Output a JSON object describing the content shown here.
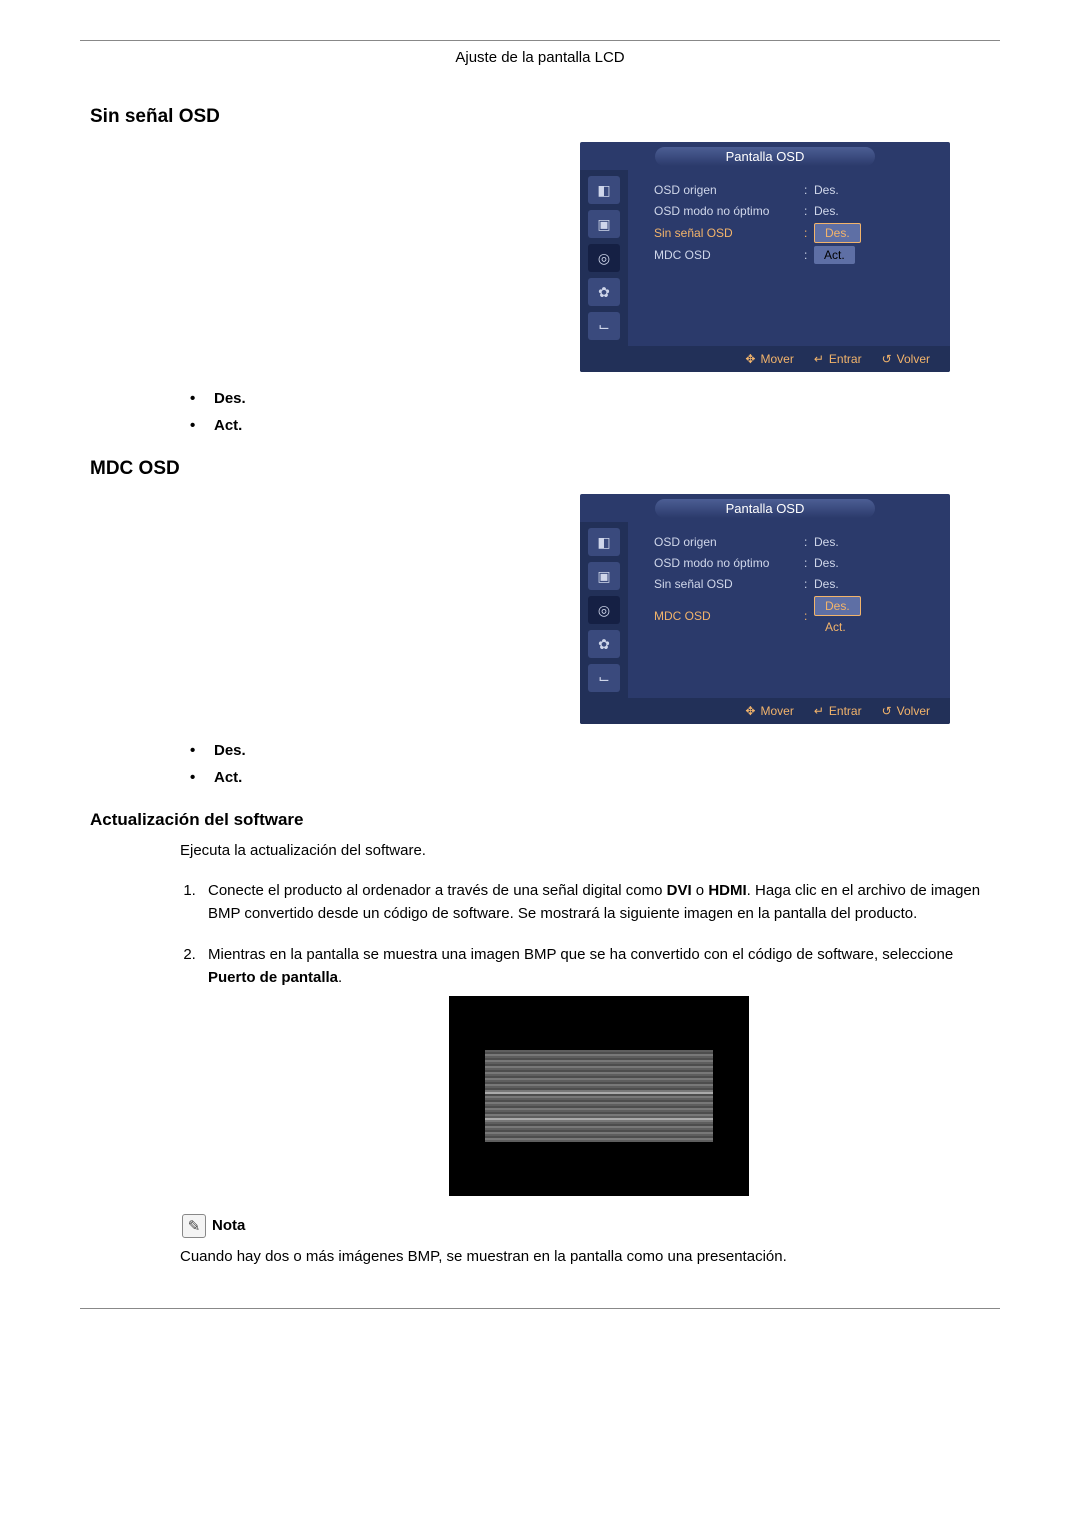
{
  "page_header": "Ajuste de la pantalla LCD",
  "sections": {
    "sin_senal": {
      "title": "Sin señal OSD",
      "bullets": [
        "Des.",
        "Act."
      ]
    },
    "mdc": {
      "title": "MDC OSD",
      "bullets": [
        "Des.",
        "Act."
      ]
    },
    "software": {
      "title": "Actualización del software",
      "intro": "Ejecuta la actualización del software.",
      "step1_a": "Conecte el producto al ordenador a través de una señal digital como ",
      "step1_b": "DVI",
      "step1_c": " o ",
      "step1_d": "HDMI",
      "step1_e": ". Haga clic en el archivo de imagen BMP convertido desde un código de software. Se mostrará la siguiente imagen en la pantalla del producto.",
      "step2_a": "Mientras en la pantalla se muestra una imagen BMP que se ha convertido con el código de software, seleccione ",
      "step2_b": "Puerto de pantalla",
      "step2_c": ".",
      "nota_label": "Nota",
      "nota_text": "Cuando hay dos o más imágenes BMP, se muestran en la pantalla como una presentación."
    }
  },
  "osd": {
    "title": "Pantalla OSD",
    "labels": {
      "origen": "OSD origen",
      "modo": "OSD modo no óptimo",
      "sin": "Sin señal OSD",
      "mdc": "MDC OSD"
    },
    "values": {
      "des": "Des.",
      "act": "Act."
    },
    "footer": {
      "mover": "Mover",
      "entrar": "Entrar",
      "volver": "Volver"
    }
  }
}
